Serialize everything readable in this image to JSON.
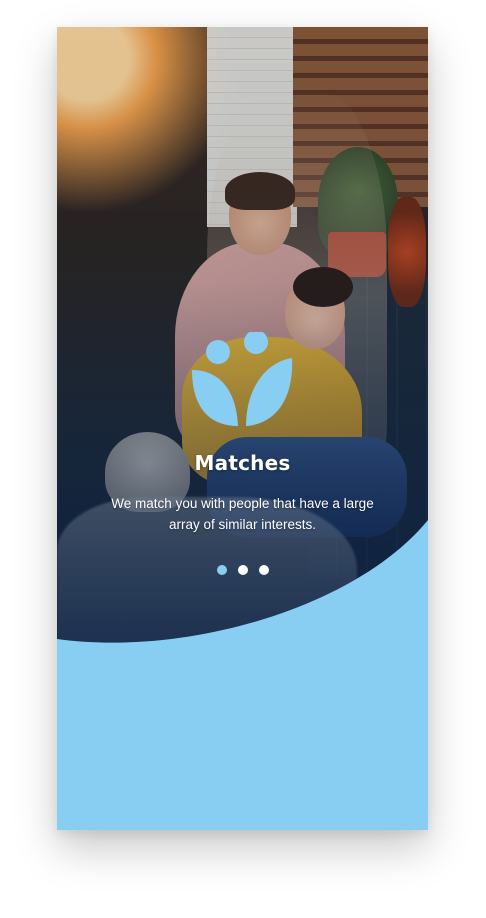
{
  "onboarding": {
    "title": "Matches",
    "description": "We match you with people that have a large array of similar interests.",
    "logo_icon": "matches-logo-icon",
    "page_indicator": {
      "count": 3,
      "active_index": 0
    }
  },
  "colors": {
    "accent": "#88cdf2",
    "text": "#ffffff"
  }
}
